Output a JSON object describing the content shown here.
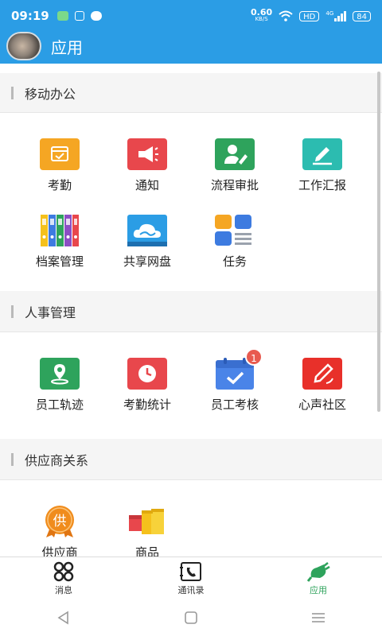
{
  "status": {
    "time": "09:19",
    "net_speed": "0.60",
    "net_unit": "KB/S",
    "hd": "HD",
    "gen": "4G",
    "battery": "84"
  },
  "header": {
    "title": "应用"
  },
  "sections": [
    {
      "title": "移动办公",
      "items": [
        {
          "label": "考勤",
          "icon": "attendance-icon",
          "color": "#f5a623"
        },
        {
          "label": "通知",
          "icon": "megaphone-icon",
          "color": "#e8474c"
        },
        {
          "label": "流程审批",
          "icon": "approval-icon",
          "color": "#2ea35c"
        },
        {
          "label": "工作汇报",
          "icon": "report-pen-icon",
          "color": "#2cbcb0"
        },
        {
          "label": "档案管理",
          "icon": "binders-icon",
          "color": "#5b8dd9"
        },
        {
          "label": "共享网盘",
          "icon": "cloud-icon",
          "color": "#2b9de5"
        },
        {
          "label": "任务",
          "icon": "task-grid-icon",
          "color": "#f5a623"
        }
      ]
    },
    {
      "title": "人事管理",
      "items": [
        {
          "label": "员工轨迹",
          "icon": "location-pin-icon",
          "color": "#2ea35c"
        },
        {
          "label": "考勤统计",
          "icon": "clock-icon",
          "color": "#e8474c"
        },
        {
          "label": "员工考核",
          "icon": "calendar-check-icon",
          "color": "#4a84e8",
          "badge": "1"
        },
        {
          "label": "心声社区",
          "icon": "pencil-icon",
          "color": "#e8302a"
        }
      ]
    },
    {
      "title": "供应商关系",
      "items": [
        {
          "label": "供应商",
          "icon": "supplier-medal-icon",
          "color": "#f08c1c",
          "glyph": "供"
        },
        {
          "label": "商品",
          "icon": "goods-boxes-icon",
          "color": "#f5c11c"
        }
      ]
    }
  ],
  "tabs": [
    {
      "label": "消息",
      "icon": "message-icon"
    },
    {
      "label": "通讯录",
      "icon": "contacts-icon"
    },
    {
      "label": "应用",
      "icon": "apps-icon",
      "active": true
    }
  ],
  "colors": {
    "primary": "#2b9de5",
    "active_tab": "#2ea35c"
  }
}
